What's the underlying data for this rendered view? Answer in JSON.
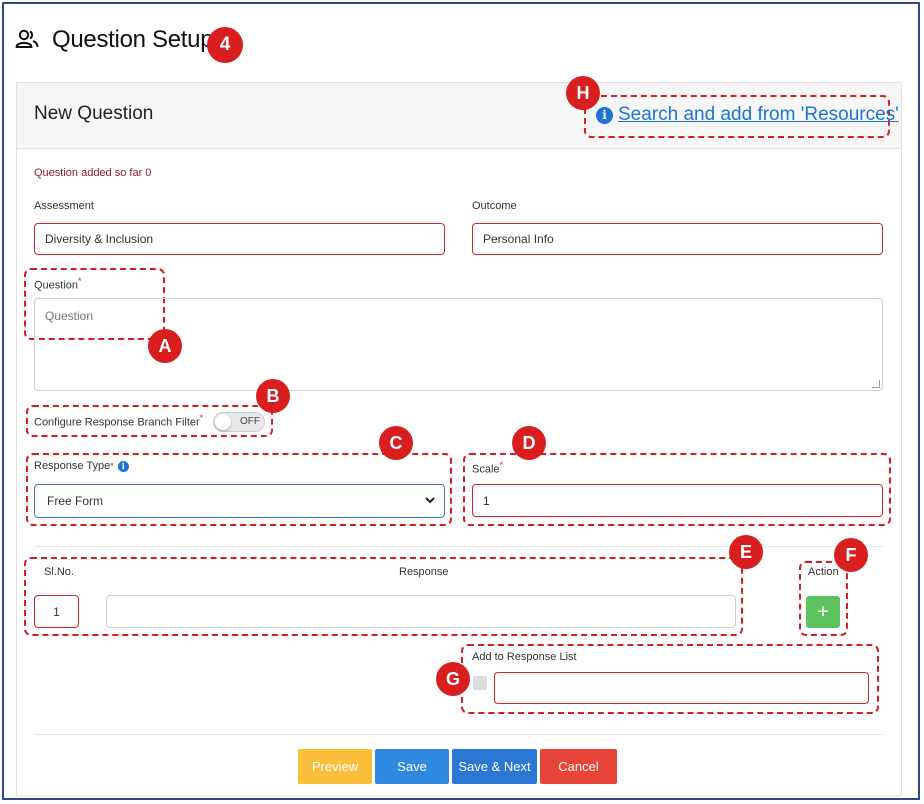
{
  "header": {
    "title": "Question Setup",
    "step_badge": "4"
  },
  "card": {
    "title": "New Question",
    "resources_link": "Search and add from 'Resources'",
    "info_symbol": "i"
  },
  "status": {
    "added_text": "Question added so far 0"
  },
  "assessment": {
    "label": "Assessment",
    "value": "Diversity & Inclusion"
  },
  "outcome": {
    "label": "Outcome",
    "value": "Personal Info"
  },
  "question": {
    "label": "Question",
    "required_mark": "*",
    "placeholder": "Question"
  },
  "branch_filter": {
    "label": "Configure Response Branch Filter",
    "required_mark": "*",
    "toggle_state": "OFF"
  },
  "response_type": {
    "label": "Response Type",
    "required_mark": "*",
    "value": "Free Form"
  },
  "scale": {
    "label": "Scale",
    "required_mark": "*",
    "value": "1"
  },
  "responses": {
    "col_slno": "Sl.No.",
    "col_response": "Response",
    "col_action": "Action",
    "row_number": "1",
    "row_value": "",
    "add_symbol": "+"
  },
  "add_to_list": {
    "label": "Add to Response List",
    "value": ""
  },
  "buttons": {
    "preview": "Preview",
    "save": "Save",
    "save_next": "Save & Next",
    "cancel": "Cancel"
  },
  "callouts": {
    "a": "A",
    "b": "B",
    "c": "C",
    "d": "D",
    "e": "E",
    "f": "F",
    "g": "G",
    "h": "H"
  },
  "colors": {
    "accent_red": "#d81e1e",
    "link_blue": "#1e73d6",
    "preview": "#fbbf3c",
    "save": "#2f89e0",
    "save_next": "#2b78d4",
    "cancel": "#e8443a",
    "add": "#5cc25e"
  }
}
